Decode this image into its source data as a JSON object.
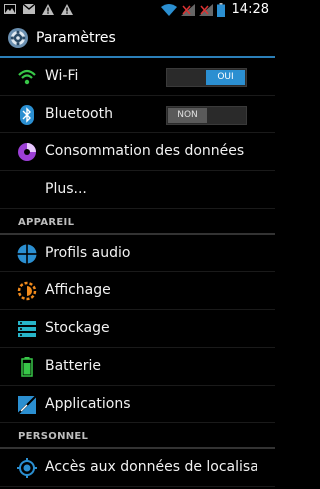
{
  "status_bar": {
    "time": "14:28",
    "left_icons": [
      "image-icon",
      "gmail-icon",
      "warning-icon",
      "warning-icon"
    ],
    "right_icons": [
      "wifi-icon",
      "signal-icon",
      "signal-icon",
      "battery-icon"
    ]
  },
  "action_bar": {
    "title": "Paramètres",
    "icon": "settings-icon"
  },
  "wireless": {
    "wifi": {
      "label": "Wi-Fi",
      "toggle": "OUI",
      "icon": "wifi-icon"
    },
    "bluetooth": {
      "label": "Bluetooth",
      "toggle": "NON",
      "icon": "bluetooth-icon"
    },
    "data_usage": {
      "label": "Consommation des données",
      "icon": "data-usage-icon"
    },
    "more": {
      "label": "Plus..."
    }
  },
  "device": {
    "header": "APPAREIL",
    "items": [
      {
        "label": "Profils audio",
        "icon": "audio-profiles-icon"
      },
      {
        "label": "Affichage",
        "icon": "display-icon"
      },
      {
        "label": "Stockage",
        "icon": "storage-icon"
      },
      {
        "label": "Batterie",
        "icon": "battery-icon"
      },
      {
        "label": "Applications",
        "icon": "applications-icon"
      }
    ]
  },
  "personal": {
    "header": "PERSONNEL",
    "items": [
      {
        "label": "Accès aux données de localisation",
        "icon": "location-icon"
      }
    ]
  },
  "colors": {
    "accent": "#2b8fd1",
    "wifi": "#38c748",
    "data": "#9c3fd6",
    "audio": "#2b8fd1",
    "display": "#f08a1c"
  }
}
